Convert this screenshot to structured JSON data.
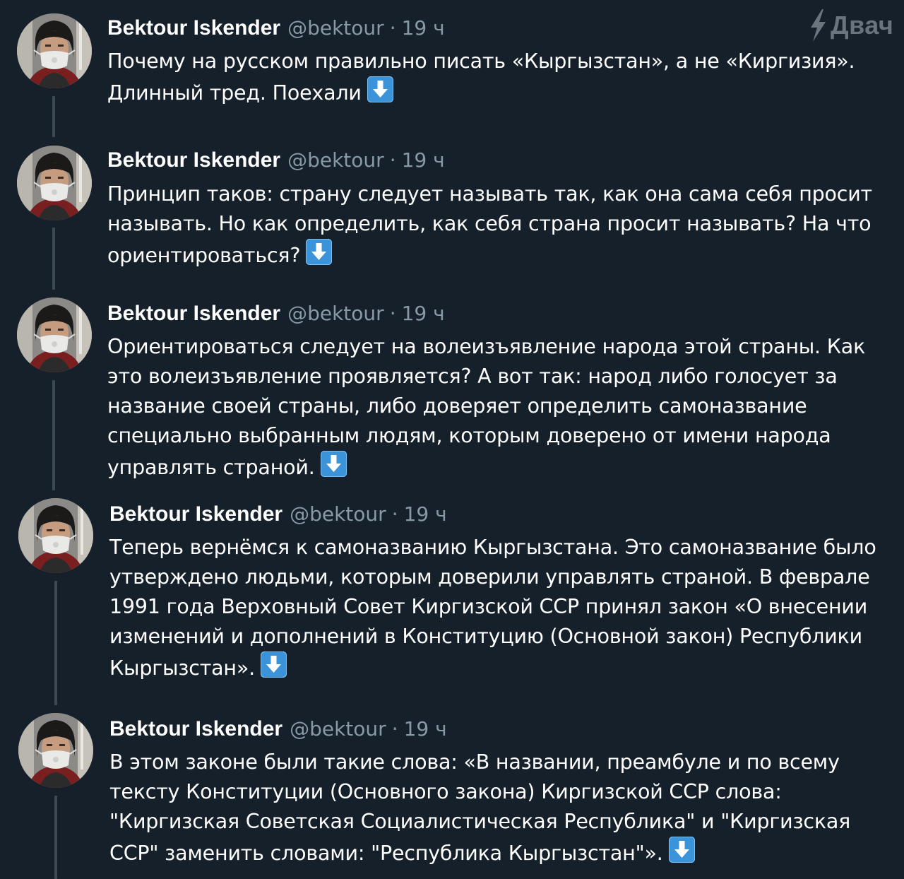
{
  "watermark": {
    "label": "Двач"
  },
  "author": {
    "name": "Bektour Iskender",
    "handle": "@bektour",
    "separator": "·",
    "time": "19 ч"
  },
  "tweets": [
    {
      "text": "Почему на русском правильно писать «Кыргызстан», а не «Киргизия». Длинный тред. Поехали",
      "emoji": "arrow-down-emoji"
    },
    {
      "text": "Принцип таков: страну следует называть так, как она сама себя просит называть. Но как определить, как себя страна просит называть? На что ориентироваться?",
      "emoji": "arrow-down-emoji"
    },
    {
      "text": "Ориентироваться следует на волеизъявление народа этой страны. Как это волеизъявление проявляется? А вот так: народ либо голосует за название своей страны, либо доверяет определить самоназвание специально выбранным людям, которым доверено от имени народа управлять страной.",
      "emoji": "arrow-down-emoji"
    },
    {
      "text": "Теперь вернёмся к самоназванию Кыргызстана. Это самоназвание было утверждено людьми, которым доверили управлять страной. В феврале 1991 года Верховный Совет Киргизской ССР принял закон «О внесении изменений и дополнений в Конституцию (Основной закон) Республики Кыргызстан».",
      "emoji": "arrow-down-emoji"
    },
    {
      "text": "В этом законе были такие слова: «В названии, преамбуле и по всему тексту Конституции (Основного закона) Киргизской ССР слова: \"Киргизская Советская Социалистическая Республика\" и \"Киргизская ССР\" заменить  словами: \"Республика Кыргызстан\"».",
      "emoji": "arrow-down-emoji"
    }
  ],
  "colors": {
    "background": "#15202b",
    "text": "#ffffff",
    "muted": "#8899a6",
    "thread_line": "#3d4955",
    "emoji_blue": "#3b94d9"
  }
}
